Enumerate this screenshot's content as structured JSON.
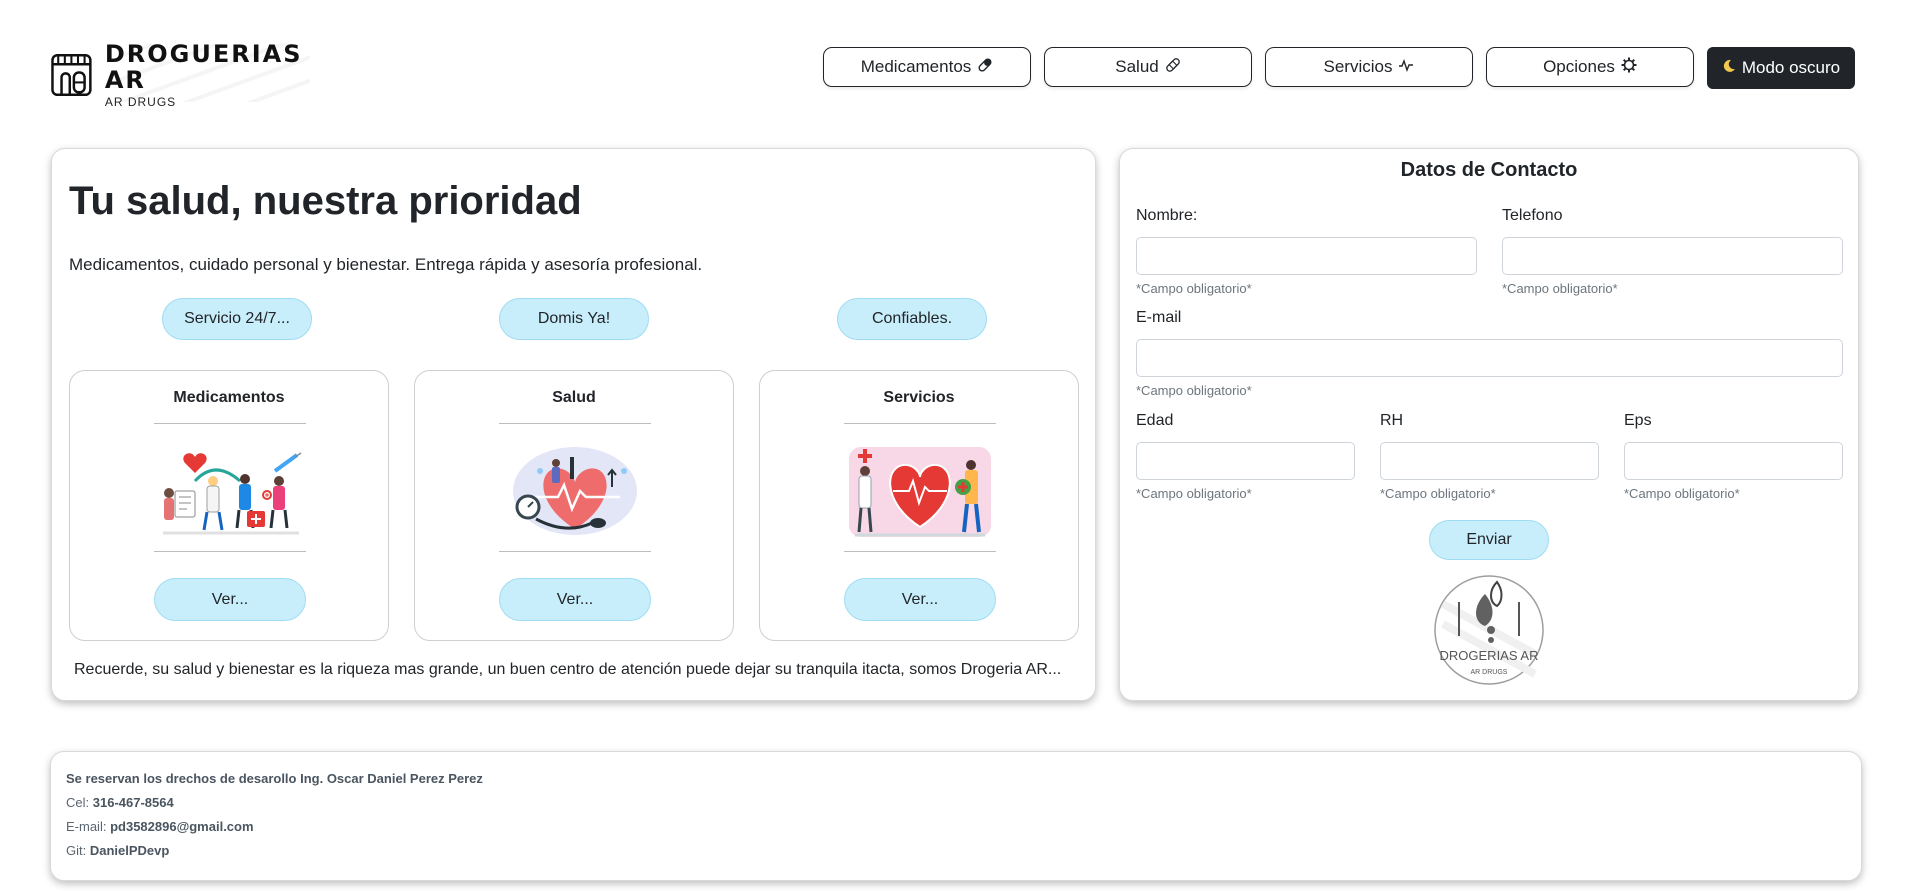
{
  "brand": {
    "name": "DROGUERIAS AR",
    "tagline": "AR DRUGS"
  },
  "nav": {
    "items": [
      {
        "label": "Medicamentos",
        "icon": "pill-icon"
      },
      {
        "label": "Salud",
        "icon": "bandage-icon"
      },
      {
        "label": "Servicios",
        "icon": "pulse-icon"
      },
      {
        "label": "Opciones",
        "icon": "gear-icon"
      }
    ],
    "dark_mode_label": "Modo oscuro"
  },
  "hero": {
    "title": "Tu salud, nuestra prioridad",
    "description": "Medicamentos, cuidado personal y bienestar. Entrega rápida y asesoría profesional.",
    "pills": [
      "Servicio 24/7...",
      "Domis Ya!",
      "Confiables."
    ]
  },
  "cards": [
    {
      "title": "Medicamentos",
      "button": "Ver..."
    },
    {
      "title": "Salud",
      "button": "Ver..."
    },
    {
      "title": "Servicios",
      "button": "Ver..."
    }
  ],
  "note": "Recuerde, su salud y bienestar es la riqueza mas grande, un buen centro de atención puede dejar su tranquila itacta, somos Drogeria AR...",
  "contact": {
    "title": "Datos de Contacto",
    "fields": {
      "nombre": "Nombre:",
      "telefono": "Telefono",
      "email": "E-mail",
      "edad": "Edad",
      "rh": "RH",
      "eps": "Eps"
    },
    "required_hint": "*Campo obligatorio*",
    "submit": "Enviar",
    "logo_text": "DROGERIAS AR",
    "logo_sub": "AR DRUGS"
  },
  "footer": {
    "rights": "Se reservan los drechos de desarollo Ing. Oscar Daniel Perez Perez",
    "cel_label": "Cel:",
    "cel_value": "316-467-8564",
    "email_label": "E-mail:",
    "email_value": "pd3582896@gmail.com",
    "git_label": "Git:",
    "git_value": "DanielPDevp"
  },
  "colors": {
    "accent_light": "#c9eefb",
    "dark": "#212529",
    "heart": "#e53935"
  }
}
